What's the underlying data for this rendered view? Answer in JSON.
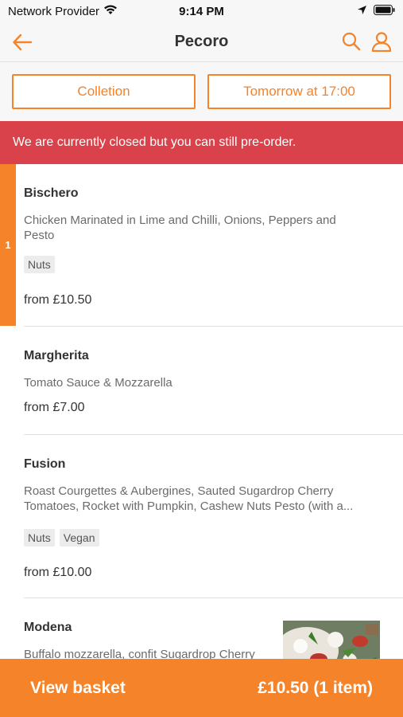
{
  "status_bar": {
    "carrier": "Network Provider",
    "time": "9:14 PM"
  },
  "header": {
    "title": "Pecoro"
  },
  "order_options": {
    "collection_label": "Colletion",
    "time_label": "Tomorrow at 17:00"
  },
  "notice": {
    "text": "We are currently closed but you can still pre-order."
  },
  "menu": {
    "items": [
      {
        "name": "Bischero",
        "description": "Chicken Marinated in Lime and Chilli, Onions, Peppers and Pesto",
        "tags": [
          "Nuts"
        ],
        "price": "from £10.50",
        "quantity": "1"
      },
      {
        "name": "Margherita",
        "description": "Tomato Sauce & Mozzarella",
        "tags": [],
        "price": "from £7.00"
      },
      {
        "name": "Fusion",
        "description_line1": "Roast Courgettes & Aubergines, Sauted Sugardrop Cherry",
        "description_line2": "Tomatoes, Rocket with Pumpkin, Cashew Nuts Pesto (with a...",
        "tags": [
          "Nuts",
          "Vegan"
        ],
        "price": "from £10.00"
      },
      {
        "name": "Modena",
        "description": "Buffalo mozzarella, confit Sugardrop Cherry"
      }
    ]
  },
  "basket": {
    "label": "View basket",
    "total": "£10.50 (1 item)"
  },
  "colors": {
    "accent": "#f5832a",
    "alert": "#d9424a"
  },
  "icons": [
    "wifi-icon",
    "location-arrow-icon",
    "battery-icon",
    "back-arrow-icon",
    "search-icon",
    "user-icon"
  ]
}
